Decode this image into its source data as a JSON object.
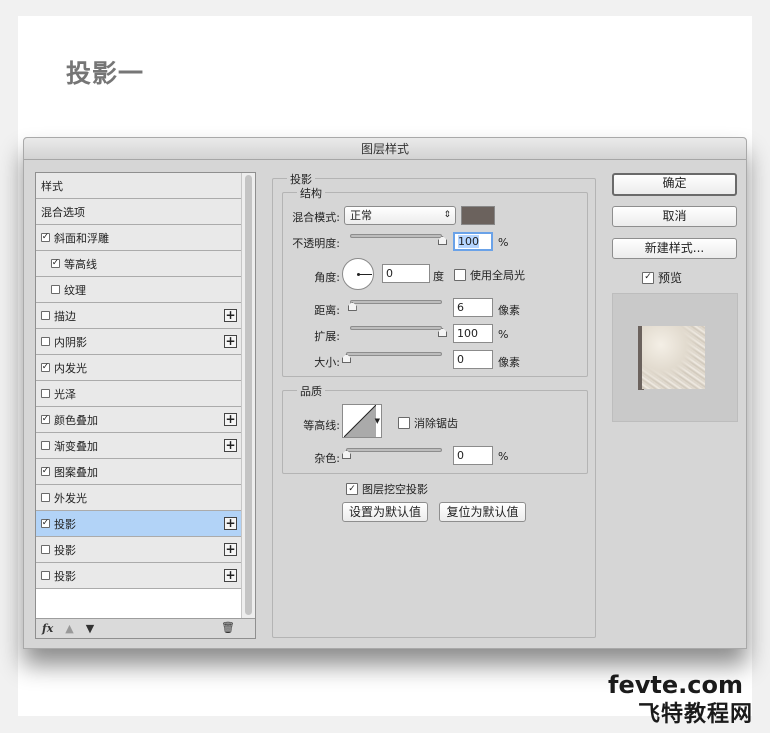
{
  "page": {
    "heading": "投影一"
  },
  "dialog": {
    "title": "图层样式",
    "styles_header": "样式",
    "styles": [
      {
        "label": "混合选项",
        "checkbox": false,
        "checked": false,
        "plus": false,
        "indent": false,
        "selected": false
      },
      {
        "label": "斜面和浮雕",
        "checkbox": true,
        "checked": true,
        "plus": false,
        "indent": false,
        "selected": false
      },
      {
        "label": "等高线",
        "checkbox": true,
        "checked": true,
        "plus": false,
        "indent": true,
        "selected": false
      },
      {
        "label": "纹理",
        "checkbox": true,
        "checked": false,
        "plus": false,
        "indent": true,
        "selected": false
      },
      {
        "label": "描边",
        "checkbox": true,
        "checked": false,
        "plus": true,
        "indent": false,
        "selected": false
      },
      {
        "label": "内阴影",
        "checkbox": true,
        "checked": false,
        "plus": true,
        "indent": false,
        "selected": false
      },
      {
        "label": "内发光",
        "checkbox": true,
        "checked": true,
        "plus": false,
        "indent": false,
        "selected": false
      },
      {
        "label": "光泽",
        "checkbox": true,
        "checked": false,
        "plus": false,
        "indent": false,
        "selected": false
      },
      {
        "label": "颜色叠加",
        "checkbox": true,
        "checked": true,
        "plus": true,
        "indent": false,
        "selected": false
      },
      {
        "label": "渐变叠加",
        "checkbox": true,
        "checked": false,
        "plus": true,
        "indent": false,
        "selected": false
      },
      {
        "label": "图案叠加",
        "checkbox": true,
        "checked": true,
        "plus": false,
        "indent": false,
        "selected": false
      },
      {
        "label": "外发光",
        "checkbox": true,
        "checked": false,
        "plus": false,
        "indent": false,
        "selected": false
      },
      {
        "label": "投影",
        "checkbox": true,
        "checked": true,
        "plus": true,
        "indent": false,
        "selected": true
      },
      {
        "label": "投影",
        "checkbox": true,
        "checked": false,
        "plus": true,
        "indent": false,
        "selected": false
      },
      {
        "label": "投影",
        "checkbox": true,
        "checked": false,
        "plus": true,
        "indent": false,
        "selected": false
      }
    ],
    "footer": {
      "fx": "fx",
      "up_icon": "arrow-up-icon",
      "down_icon": "arrow-down-icon",
      "trash_icon": "trash-icon"
    },
    "shadow": {
      "section_title": "投影",
      "structure_title": "结构",
      "blend_mode_label": "混合模式:",
      "blend_mode_value": "正常",
      "shadow_color": "#6b625d",
      "opacity_label": "不透明度:",
      "opacity_value": "100",
      "opacity_unit": "%",
      "opacity_level": 1.0,
      "angle_label": "角度:",
      "angle_value": "0",
      "angle_unit": "度",
      "global_light_label": "使用全局光",
      "global_light_checked": false,
      "distance_label": "距离:",
      "distance_value": "6",
      "distance_unit": "像素",
      "distance_level": 0.02,
      "spread_label": "扩展:",
      "spread_value": "100",
      "spread_unit": "%",
      "spread_level": 1.0,
      "size_label": "大小:",
      "size_value": "0",
      "size_unit": "像素",
      "size_level": 0.0,
      "quality_title": "品质",
      "contour_label": "等高线:",
      "antialias_label": "消除锯齿",
      "antialias_checked": false,
      "noise_label": "杂色:",
      "noise_value": "0",
      "noise_unit": "%",
      "noise_level": 0.0,
      "knockout_label": "图层挖空投影",
      "knockout_checked": true,
      "make_default_button": "设置为默认值",
      "reset_default_button": "复位为默认值"
    },
    "buttons": {
      "ok": "确定",
      "cancel": "取消",
      "new_style": "新建样式...",
      "preview_label": "预览",
      "preview_checked": true
    }
  },
  "watermark": {
    "line1": "fevte.com",
    "line2": "飞特教程网"
  }
}
